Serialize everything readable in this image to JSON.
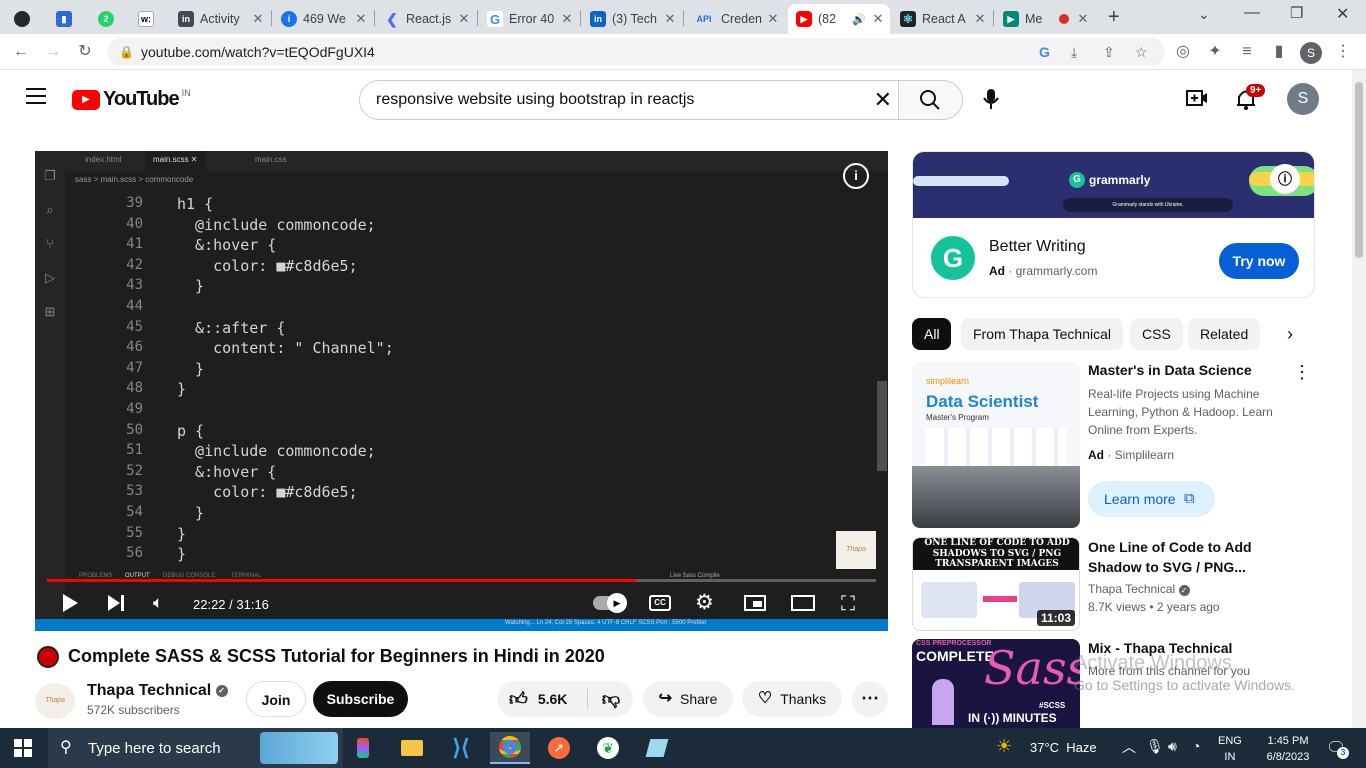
{
  "browser": {
    "tabs": [
      {
        "title": "",
        "icon": "github-icon"
      },
      {
        "title": "",
        "icon": "bookmark-icon"
      },
      {
        "title": "",
        "icon": "whatsapp-icon",
        "badge": "2"
      },
      {
        "title": "",
        "icon": "wikipedia-icon"
      },
      {
        "title": "Activity",
        "icon": "linkedin-icon"
      },
      {
        "title": "469 We",
        "icon": "info-icon"
      },
      {
        "title": "React.js",
        "icon": "react-icon"
      },
      {
        "title": "Error 40",
        "icon": "google-icon"
      },
      {
        "title": "(3) Tech",
        "icon": "linkedin-icon"
      },
      {
        "title": "Creden",
        "icon": "api-icon",
        "prefix": "API"
      },
      {
        "title": "(82",
        "icon": "youtube-icon"
      },
      {
        "title": "React A",
        "icon": "react-icon"
      },
      {
        "title": "Me",
        "icon": "meet-icon"
      }
    ],
    "url": "youtube.com/watch?v=tEQOdFgUXI4",
    "profile_initial": "S"
  },
  "youtube": {
    "logo_text": "YouTube",
    "country": "IN",
    "search_value": "responsive website using bootstrap in reactjs",
    "notification_count": "9+",
    "avatar_initial": "S"
  },
  "video": {
    "tabs": [
      "index.html",
      "main.scss",
      "main.css"
    ],
    "breadcrumb": "sass > main.scss > commoncode",
    "code_lines": [
      {
        "n": "39",
        "text": "h1 {"
      },
      {
        "n": "40",
        "text": "  @include commoncode;"
      },
      {
        "n": "41",
        "text": "  &:hover {"
      },
      {
        "n": "42",
        "text": "    color: ■#c8d6e5;"
      },
      {
        "n": "43",
        "text": "  }"
      },
      {
        "n": "44",
        "text": ""
      },
      {
        "n": "45",
        "text": "  &::after {"
      },
      {
        "n": "46",
        "text": "    content: \" Channel\";"
      },
      {
        "n": "47",
        "text": "  }"
      },
      {
        "n": "48",
        "text": "}"
      },
      {
        "n": "49",
        "text": ""
      },
      {
        "n": "50",
        "text": "p {"
      },
      {
        "n": "51",
        "text": "  @include commoncode;"
      },
      {
        "n": "52",
        "text": "  &:hover {"
      },
      {
        "n": "53",
        "text": "    color: ■#c8d6e5;"
      },
      {
        "n": "54",
        "text": "  }"
      },
      {
        "n": "55",
        "text": "}"
      },
      {
        "n": "56",
        "text": "}"
      }
    ],
    "time": "22:22 / 31:16",
    "progress": 0.71,
    "panel_tabs": [
      "PROBLEMS",
      "OUTPUT",
      "DEBUG CONSOLE",
      "TERMINAL"
    ],
    "panel_select": "Live Sass Compile",
    "status_bar": "Watching...   Ln 24, Col 29   Spaces: 4   UTF-8   CRLF   SCSS   Port : 5500   Prettier",
    "title": "Complete SASS & SCSS Tutorial for Beginners in Hindi in 2020"
  },
  "channel": {
    "name": "Thapa Technical",
    "subscribers": "572K subscribers",
    "join": "Join",
    "subscribe": "Subscribe",
    "likes": "5.6K",
    "share": "Share",
    "thanks": "Thanks"
  },
  "ad": {
    "banner_brand": "grammarly",
    "banner_tagline": "Grammarly stands with Ukraine.",
    "title": "Better Writing",
    "ad_label": "Ad",
    "domain": "grammarly.com",
    "cta": "Try now"
  },
  "chips": [
    "All",
    "From Thapa Technical",
    "CSS",
    "Related"
  ],
  "recs": [
    {
      "title": "Master's in Data Science",
      "desc": "Real-life Projects using Machine Learning, Python & Hadoop. Learn Online from Experts.",
      "ad_label": "Ad",
      "advertiser": "Simplilearn",
      "cta": "Learn more",
      "thumb_brand": "simplilearn",
      "thumb_title": "Data Scientist",
      "thumb_sub": "Master's Program"
    },
    {
      "title": "One Line of Code to Add Shadow to SVG / PNG...",
      "channel": "Thapa Technical",
      "meta": "8.7K views • 2 years ago",
      "duration": "11:03",
      "thumb_text": "ONE LINE OF CODE TO ADD SHADOWS TO SVG / PNG TRANSPARENT IMAGES"
    },
    {
      "title": "Mix - Thapa Technical",
      "desc": "More from this channel for you",
      "thumb_top": "CSS PREPROCESSOR",
      "thumb_main": "COMPLETE",
      "thumb_sass": "Sass",
      "thumb_tag": "#SCSS",
      "thumb_bottom": "IN (·)) MINUTES"
    }
  ],
  "watermark": {
    "line1": "Activate Windows",
    "line2": "Go to Settings to activate Windows."
  },
  "taskbar": {
    "search_placeholder": "Type here to search",
    "weather": "37°C  Haze",
    "lang1": "ENG",
    "lang2": "IN",
    "time": "1:45 PM",
    "date": "6/8/2023",
    "notif_count": "3"
  }
}
